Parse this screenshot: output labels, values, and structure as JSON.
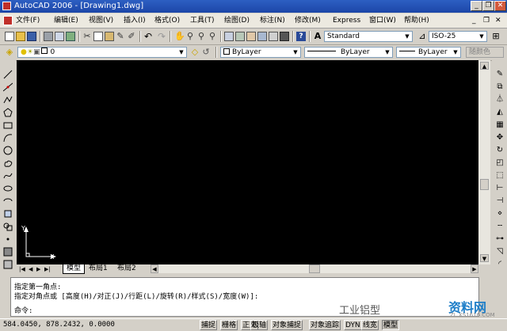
{
  "titlebar": {
    "title": "AutoCAD 2006 - [Drawing1.dwg]",
    "minimize": "_",
    "restore": "❐",
    "close": "✕"
  },
  "menu": {
    "items": [
      "文件(F)",
      "编辑(E)",
      "视图(V)",
      "插入(I)",
      "格式(O)",
      "工具(T)",
      "绘图(D)",
      "标注(N)",
      "修改(M)",
      "Express",
      "窗口(W)",
      "帮助(H)"
    ],
    "doc_min": "_",
    "doc_restore": "❐",
    "doc_close": "✕"
  },
  "standard": {
    "text_style": "Standard",
    "dim_style": "ISO-25"
  },
  "layers": {
    "current_layer": "0",
    "color": "ByLayer",
    "linetype": "ByLayer",
    "lineweight": "ByLayer",
    "plot_style": "随颜色"
  },
  "tabs": [
    "模型",
    "布局1",
    "布局2"
  ],
  "ucs": {
    "x": "X",
    "y": "Y"
  },
  "command": {
    "line1": "指定第一角点:",
    "line2": "指定对角点或 [高度(H)/对正(J)/行距(L)/旋转(R)/样式(S)/宽度(W)]:",
    "prompt": "命令:"
  },
  "status": {
    "coords": "584.0450, 878.2432, 0.0000",
    "buttons": [
      "捕捉",
      "栅格",
      "正交",
      "极轴",
      "对象捕捉",
      "对象追踪",
      "DYN",
      "线宽",
      "模型"
    ]
  },
  "watermark": {
    "left": "工业铝型",
    "brand": "资料网",
    "url": "ZL.XS1616.COM"
  }
}
